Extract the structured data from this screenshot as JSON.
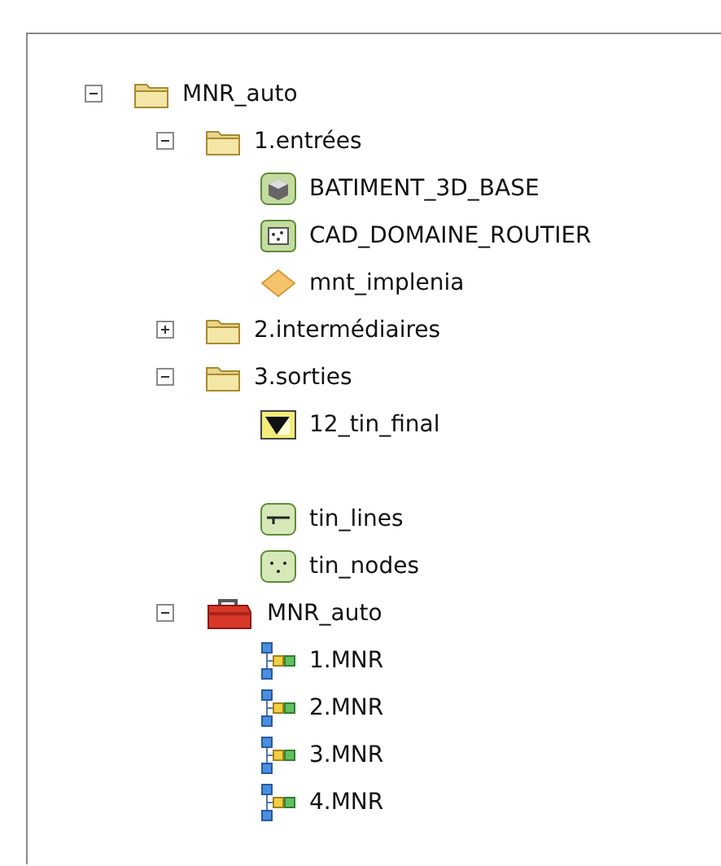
{
  "tree": [
    {
      "label": "MNR_auto",
      "kind": "folder",
      "expanded": true,
      "children": [
        {
          "label": "1.entrées",
          "kind": "folder",
          "expanded": true,
          "children": [
            {
              "label": "BATIMENT_3D_BASE",
              "kind": "multipatch"
            },
            {
              "label": "CAD_DOMAINE_ROUTIER",
              "kind": "cad"
            },
            {
              "label": "mnt_implenia",
              "kind": "terrain"
            }
          ]
        },
        {
          "label": "2.intermédiaires",
          "kind": "folder",
          "expanded": false
        },
        {
          "label": "3.sorties",
          "kind": "folder",
          "expanded": true,
          "children": [
            {
              "label": "12_tin_final",
              "kind": "tin"
            },
            {
              "label": "tin_lines",
              "kind": "lines",
              "gap_before": true
            },
            {
              "label": "tin_nodes",
              "kind": "points"
            }
          ]
        },
        {
          "label": "MNR_auto",
          "kind": "toolbox",
          "expanded": true,
          "children": [
            {
              "label": "1.MNR",
              "kind": "model"
            },
            {
              "label": "2.MNR",
              "kind": "model"
            },
            {
              "label": "3.MNR",
              "kind": "model"
            },
            {
              "label": "4.MNR",
              "kind": "model"
            }
          ]
        }
      ]
    }
  ]
}
